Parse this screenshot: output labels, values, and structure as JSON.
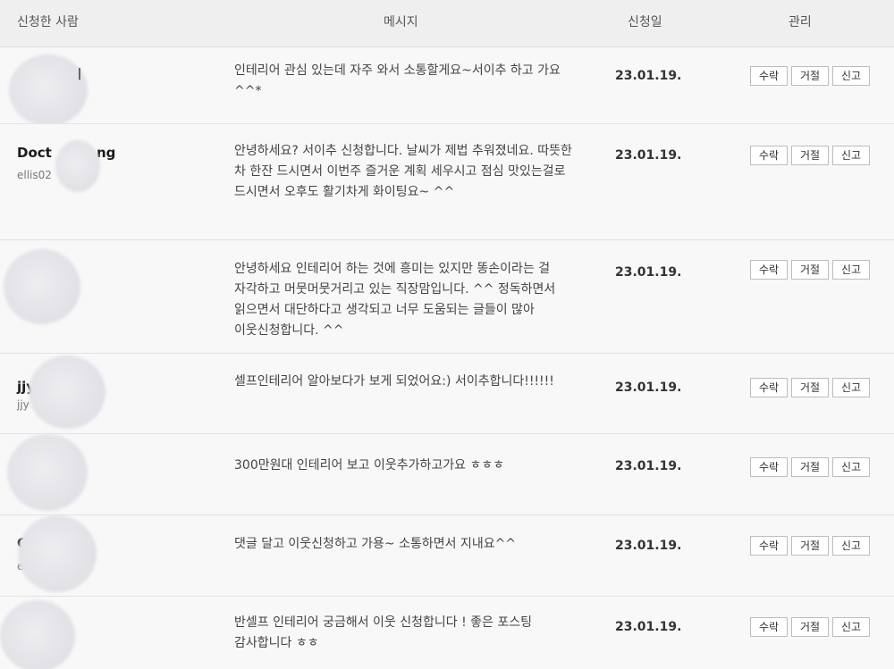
{
  "header": {
    "applicant": "신청한 사람",
    "message": "메시지",
    "date": "신청일",
    "manage": "관리"
  },
  "actions": {
    "accept": "수락",
    "reject": "거절",
    "report": "신고"
  },
  "rows": [
    {
      "name": "",
      "name_partial_visible": "ㅣ",
      "user_id": "",
      "message": "인테리어 관심 있는데 자주 와서 소통할게요~서이추 하고 가요^^*",
      "date": "23.01.19."
    },
    {
      "name": "Doct",
      "name_tail": "ng",
      "user_id": "ellis02",
      "message": "안녕하세요? 서이추 신청합니다. 날씨가 제법 추워졌네요. 따뜻한 차 한잔 드시면서 이번주 즐거운 계획 세우시고 점심 맛있는걸로 드시면서 오후도 활기차게 화이팅요~ ^^",
      "date": "23.01.19."
    },
    {
      "name": "",
      "name_tail": "",
      "user_id": "",
      "message": "안녕하세요 인테리어 하는 것에 흥미는 있지만 똥손이라는 걸 자각하고 머뭇머뭇거리고 있는 직장맘입니다. ^^ 정독하면서 읽으면서 대단하다고 생각되고 너무 도움되는 글들이 많아 이웃신청합니다. ^^",
      "date": "23.01.19."
    },
    {
      "name": "jjy",
      "name_tail": "",
      "user_id": "jjy",
      "message": "셀프인테리어 알아보다가 보게 되었어요:) 서이추합니다!!!!!!",
      "date": "23.01.19."
    },
    {
      "name": "",
      "name_tail": "",
      "user_id": "",
      "message": "300만원대 인테리어 보고 이웃추가하고가요 ㅎㅎㅎ",
      "date": "23.01.19."
    },
    {
      "name": "C",
      "name_tail": "",
      "user_id": "e",
      "message": "댓글 달고 이웃신청하고 가용~ 소통하면서 지내요^^",
      "date": "23.01.19."
    },
    {
      "name": "",
      "name_tail": "",
      "user_id": "",
      "message": "반셀프 인테리어 궁금해서 이웃 신청합니다 ! 좋은 포스팅 감사합니다 ㅎㅎ",
      "date": "23.01.19."
    }
  ]
}
